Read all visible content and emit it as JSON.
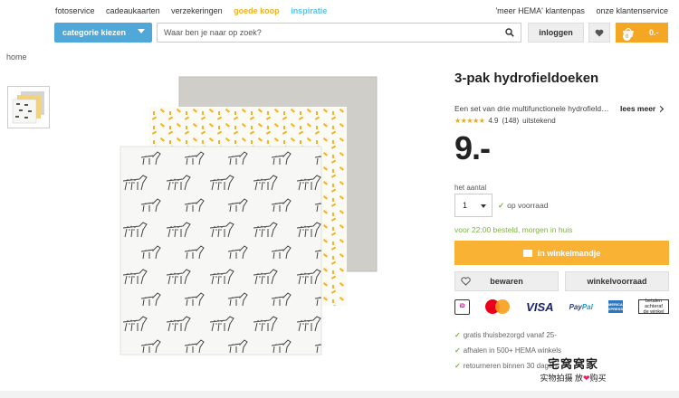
{
  "topnav": {
    "left": [
      "fotoservice",
      "cadeaukaarten",
      "verzekeringen",
      "goede koop",
      "inspiratie"
    ],
    "right": [
      "'meer HEMA' klantenpas",
      "onze klantenservice"
    ]
  },
  "header": {
    "category_button": "categorie kiezen",
    "search_placeholder": "Waar ben je naar op zoek?",
    "login": "inloggen",
    "cart_count": "0",
    "cart_total": "0.-"
  },
  "breadcrumb": "home",
  "product": {
    "title": "3-pak hydrofieldoeken",
    "description": "Een set van drie multifunctionele hydrofieldoeken",
    "read_more": "lees meer",
    "rating_value": "4.9",
    "rating_count": "(148)",
    "rating_text": "uitstekend",
    "rating_stars": 4.9,
    "price": "9.-",
    "qty_label": "het aantal",
    "qty_value": "1",
    "stock_status": "op voorraad",
    "delivery": "voor 22:00 besteld, morgen in huis",
    "add_to_cart": "in winkelmandje",
    "save": "bewaren",
    "store_stock": "winkelvoorraad"
  },
  "payments": {
    "ideal": "iD",
    "visa": "VISA",
    "paypal_a": "Pay",
    "paypal_b": "Pal",
    "amex": "AMERICAN EXPRESS",
    "later_1": "betalen",
    "later_2": "achteraf",
    "later_3": "de winkel"
  },
  "usps": [
    "gratis thuisbezorgd vanaf 25-",
    "afhalen in 500+ HEMA winkels",
    "retourneren binnen 30 dagen"
  ],
  "watermark": {
    "line1": "宅窝窝家",
    "line2_a": "实物拍摄",
    "line2_b": "放",
    "line2_c": "购买"
  },
  "colors": {
    "accent_blue": "#4fa8d8",
    "cart_orange": "#f5a623",
    "add_to_cart": "#f9b233",
    "stock_green": "#7cb342"
  }
}
